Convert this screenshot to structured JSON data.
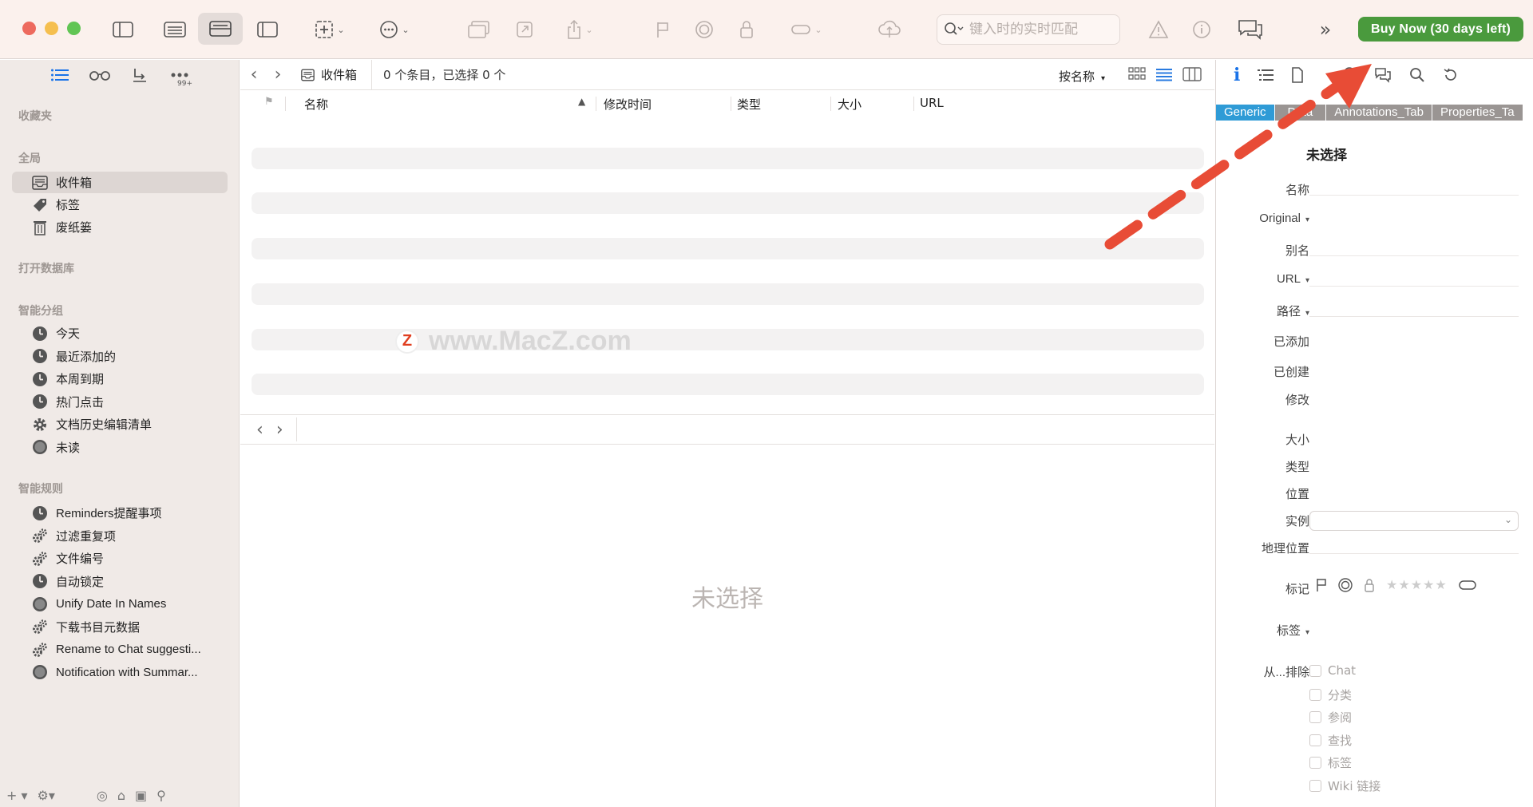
{
  "toolbar": {
    "search_placeholder": "键入时的实时匹配",
    "buy_label": "Buy Now (30 days left)",
    "buy_color": "#4a9a3d"
  },
  "sidebar": {
    "sections": {
      "favorites": "收藏夹",
      "global": "全局",
      "open_db": "打开数据库",
      "smart_groups": "智能分组",
      "smart_rules": "智能规则"
    },
    "global_items": [
      {
        "label": "收件箱",
        "icon": "inbox-icon"
      },
      {
        "label": "标签",
        "icon": "tag-icon"
      },
      {
        "label": "废纸篓",
        "icon": "trash-icon"
      }
    ],
    "smart_groups": [
      {
        "label": "今天",
        "icon": "clock-icon"
      },
      {
        "label": "最近添加的",
        "icon": "clock-icon"
      },
      {
        "label": "本周到期",
        "icon": "clock-icon"
      },
      {
        "label": "热门点击",
        "icon": "clock-icon"
      },
      {
        "label": "文档历史编辑清单",
        "icon": "gear-icon"
      },
      {
        "label": "未读",
        "icon": "circle-icon"
      }
    ],
    "smart_rules": [
      {
        "label": "Reminders提醒事项",
        "icon": "clock-icon"
      },
      {
        "label": "过滤重复项",
        "icon": "gears-icon"
      },
      {
        "label": "文件编号",
        "icon": "gears-icon"
      },
      {
        "label": "自动锁定",
        "icon": "clock-icon"
      },
      {
        "label": "Unify Date In Names",
        "icon": "circle-icon"
      },
      {
        "label": "下载书目元数据",
        "icon": "gears-icon"
      },
      {
        "label": "Rename to Chat suggesti...",
        "icon": "gears-icon"
      },
      {
        "label": "Notification with Summar...",
        "icon": "circle-icon"
      }
    ],
    "tab_badge": "99+"
  },
  "main": {
    "crumb": "收件箱",
    "status": "0 个条目，已选择 0 个",
    "sort_label": "按名称",
    "columns": [
      "名称",
      "修改时间",
      "类型",
      "大小",
      "URL"
    ],
    "empty_text": "未选择",
    "watermark": "www.MacZ.com",
    "watermark_logo": "Z"
  },
  "inspector": {
    "subtabs": [
      "Generic",
      "Data",
      "Annotations_Tab",
      "Properties_Ta"
    ],
    "title": "未选择",
    "fields": {
      "name": "名称",
      "original": "Original",
      "alias": "别名",
      "url": "URL",
      "path": "路径",
      "added": "已添加",
      "created": "已创建",
      "modified": "修改",
      "size": "大小",
      "type": "类型",
      "location": "位置",
      "instance": "实例",
      "geo": "地理位置",
      "mark": "标记",
      "tags": "标签",
      "exclude": "从...排除"
    },
    "exclude_options": [
      "Chat",
      "分类",
      "参阅",
      "查找",
      "标签",
      "Wiki 链接"
    ]
  }
}
